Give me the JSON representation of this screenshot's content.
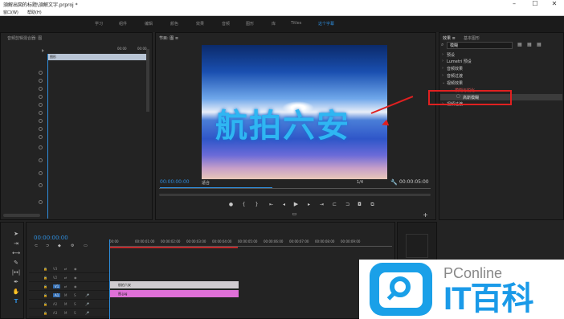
{
  "title": "須解出図的标题\\須解文字.prproj *",
  "menu": {
    "window": "窗口(W)",
    "help": "帮助(H)"
  },
  "workspaces": [
    "学习",
    "组件",
    "编辑",
    "颜色",
    "效果",
    "音频",
    "图形",
    "库",
    "Titles",
    "这个字幕"
  ],
  "left_panel": {
    "tab": "音频剪辑混合器: 图"
  },
  "source": {
    "clip_label": "图形",
    "time_start": "00:00",
    "time_end": "00:00"
  },
  "program": {
    "tab": "节目: 图 ≡",
    "timecode_in": "00:00:00:00",
    "fit": "适合",
    "quality": "1/4",
    "timecode_out": "00:00:05:00"
  },
  "video_text": "航拍六安",
  "effects": {
    "tabs": [
      "效果 ≡",
      "基本图形"
    ],
    "search": "模糊",
    "items": [
      "预设",
      "Lumetri 预设",
      "音频效果",
      "音频过渡",
      "视频效果",
      "模糊与锐化",
      "高斯模糊",
      "视频过渡"
    ]
  },
  "timeline": {
    "timecode": "00:00:00:00",
    "ruler": [
      "00:00",
      "00:00:01:00",
      "00:00:02:00",
      "00:00:03:00",
      "00:00:04:00",
      "00:00:05:00",
      "00:00:06:00",
      "00:00:07:00",
      "00:00:08:00",
      "00:00:09:00"
    ],
    "tracks": [
      "V3",
      "V2",
      "V1",
      "A1",
      "A2",
      "A3"
    ],
    "clip1": "航拍六安",
    "clip2": "图.jpg"
  },
  "watermark": {
    "line1": "PConline",
    "line2": "IT百科"
  },
  "colors": {
    "accent": "#2e8ede",
    "highlight": "#e02020",
    "clip_title": "#d0ccd0",
    "clip_image": "#e070d8"
  }
}
